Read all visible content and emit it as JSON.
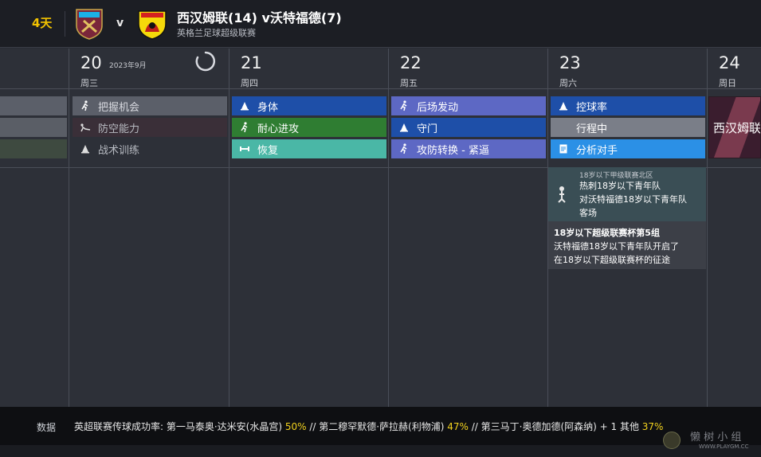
{
  "header": {
    "days_left": "4天",
    "vs": "v",
    "title": "西汉姆联(14) v沃特福德(7)",
    "subtitle": "英格兰足球超级联赛"
  },
  "calendar": {
    "month": "2023年9月",
    "days": [
      {
        "num": "20",
        "weekday": "周三"
      },
      {
        "num": "21",
        "weekday": "周四"
      },
      {
        "num": "22",
        "weekday": "周五"
      },
      {
        "num": "23",
        "weekday": "周六"
      },
      {
        "num": "24",
        "weekday": "周日"
      }
    ],
    "col20": [
      "把握机会",
      "防空能力",
      "战术训练"
    ],
    "col21": [
      "身体",
      "耐心进攻",
      "恢复"
    ],
    "col22": [
      "后场发动",
      "守门",
      "攻防转换 - 紧逼"
    ],
    "col23": [
      "控球率",
      "行程中",
      "分析对手"
    ],
    "match_card": "西汉姆联"
  },
  "news": {
    "league_small": "18岁以下甲级联赛北区",
    "line1": "热刺18岁以下青年队",
    "line2": "对沃特福德18岁以下青年队",
    "line3": "客场",
    "cup1": "18岁以下超级联赛杯第5组",
    "cup2": "沃特福德18岁以下青年队开启了",
    "cup3": "在18岁以下超级联赛杯的征途"
  },
  "footer": {
    "label": "数据",
    "text_a": "英超联赛传球成功率: 第一马泰奥·达米安(水晶宫) ",
    "pct1": "50%",
    "text_b": " // 第二穆罕默德·萨拉赫(利物浦) ",
    "pct2": "47%",
    "text_c": " // 第三马丁·奥德加德(阿森纳) + 1 其他 ",
    "pct3": "37%"
  },
  "watermark": {
    "cn": "懒 树 小 组",
    "url": "WWW.PLAYGM.CC"
  }
}
